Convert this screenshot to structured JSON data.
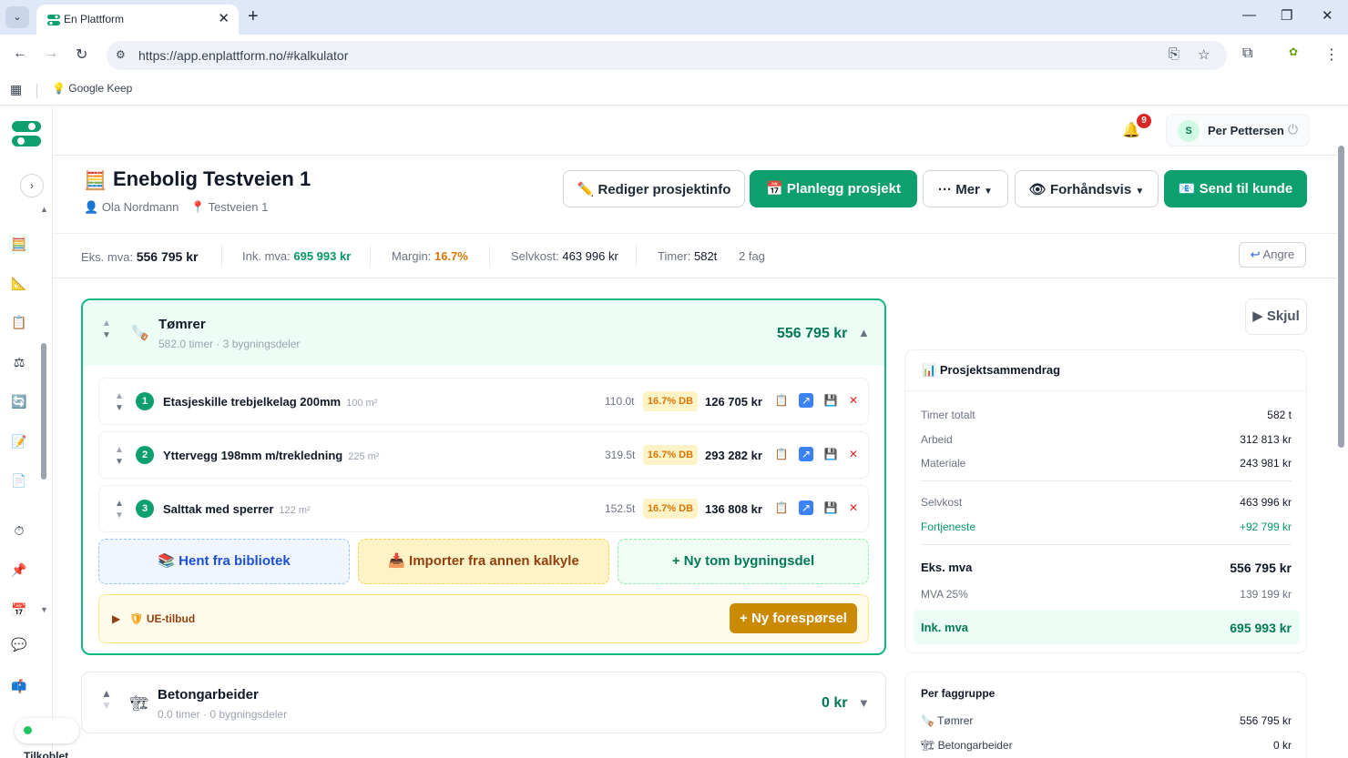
{
  "browser": {
    "tab_title": "En Plattform",
    "url": "https://app.enplattform.no/#kalkulator",
    "bookmark": "Google Keep"
  },
  "header": {
    "notification_count": "9",
    "user_initial": "S",
    "user_name": "Per Pettersen"
  },
  "project": {
    "title": "Enebolig Testveien 1",
    "customer": "Ola Nordmann",
    "address": "Testveien 1",
    "buttons": {
      "edit": "Rediger prosjektinfo",
      "plan": "Planlegg prosjekt",
      "more": "··· Mer",
      "preview": "Forhåndsvis",
      "send": "Send til kunde"
    }
  },
  "stats": {
    "eks_label": "Eks. mva:",
    "eks_value": "556 795 kr",
    "ink_label": "Ink. mva:",
    "ink_value": "695 993 kr",
    "margin_label": "Margin:",
    "margin_value": "16.7%",
    "selvkost_label": "Selvkost:",
    "selvkost_value": "463 996 kr",
    "timer_label": "Timer:",
    "timer_value": "582t",
    "fag": "2 fag",
    "undo": "Angre"
  },
  "trades": [
    {
      "name": "Tømrer",
      "sub": "582.0 timer · 3 bygningsdeler",
      "total": "556 795 kr",
      "parts": [
        {
          "num": "1",
          "name": "Etasjeskille trebjelkelag 200mm",
          "area": "100 m²",
          "hours": "110.0t",
          "db": "16.7% DB",
          "price": "126 705 kr"
        },
        {
          "num": "2",
          "name": "Yttervegg 198mm m/trekledning",
          "area": "225 m²",
          "hours": "319.5t",
          "db": "16.7% DB",
          "price": "293 282 kr"
        },
        {
          "num": "3",
          "name": "Salttak med sperrer",
          "area": "122 m²",
          "hours": "152.5t",
          "db": "16.7% DB",
          "price": "136 808 kr"
        }
      ],
      "add_library": "Hent fra bibliotek",
      "add_import": "Importer fra annen kalkyle",
      "add_new": "+ Ny tom bygningsdel",
      "ue_label": "UE-tilbud",
      "ue_button": "+ Ny forespørsel"
    },
    {
      "name": "Betongarbeider",
      "sub": "0.0 timer · 0 bygningsdeler",
      "total": "0 kr"
    }
  ],
  "summary": {
    "hide": "Skjul",
    "title": "Prosjektsammendrag",
    "timer_label": "Timer totalt",
    "timer_value": "582 t",
    "arbeid_label": "Arbeid",
    "arbeid_value": "312 813 kr",
    "materiale_label": "Materiale",
    "materiale_value": "243 981 kr",
    "selvkost_label": "Selvkost",
    "selvkost_value": "463 996 kr",
    "fortjeneste_label": "Fortjeneste",
    "fortjeneste_value": "+92 799 kr",
    "eks_label": "Eks. mva",
    "eks_value": "556 795 kr",
    "mva_label": "MVA 25%",
    "mva_value": "139 199 kr",
    "ink_label": "Ink. mva",
    "ink_value": "695 993 kr"
  },
  "faggruppe": {
    "title": "Per faggruppe",
    "rows": [
      {
        "name": "Tømrer",
        "value": "556 795 kr"
      },
      {
        "name": "Betongarbeider",
        "value": "0 kr"
      }
    ]
  },
  "status": {
    "connection": "Tilkoblet"
  },
  "colors": {
    "accent": "#0e9f6e",
    "warning": "#d97706",
    "danger": "#dc2626"
  }
}
